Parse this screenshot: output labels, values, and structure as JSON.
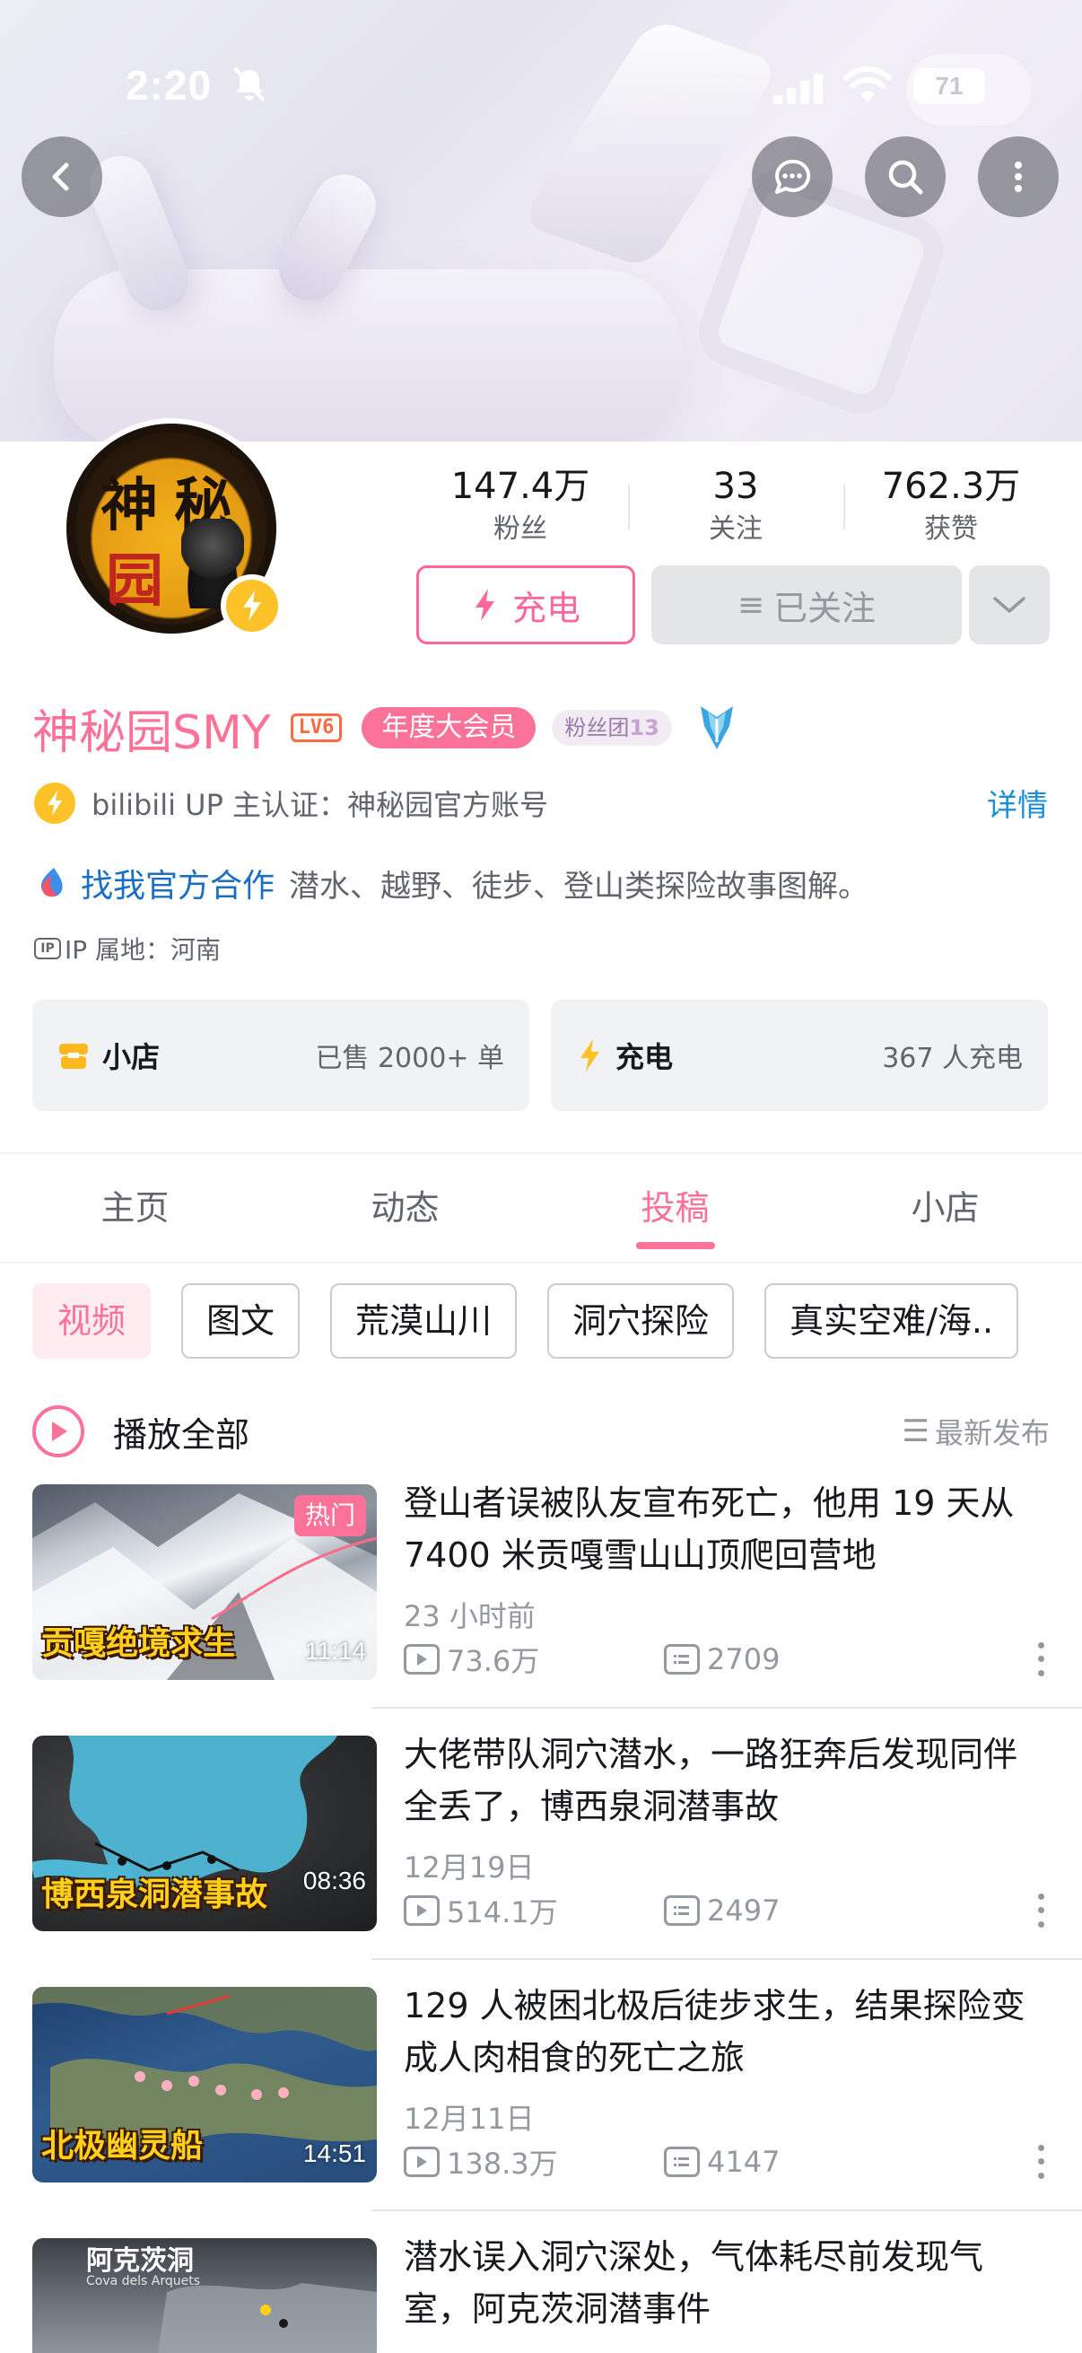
{
  "status_bar": {
    "time": "2:20",
    "battery": "71"
  },
  "header": {
    "icons": [
      "back-icon",
      "message-icon",
      "search-icon",
      "more-icon"
    ]
  },
  "profile": {
    "avatar_text": [
      "神",
      "秘",
      "园"
    ],
    "stats": [
      {
        "value": "147.4万",
        "label": "粉丝"
      },
      {
        "value": "33",
        "label": "关注"
      },
      {
        "value": "762.3万",
        "label": "获赞"
      }
    ],
    "charge_button": "充电",
    "followed_button": "已关注",
    "name": "神秘园SMY",
    "level": "LV6",
    "vip": "年度大会员",
    "fan_group": "粉丝团",
    "fan_level": "13",
    "auth": "bilibili UP 主认证：神秘园官方账号",
    "auth_detail": "详情",
    "bio_link": "找我官方合作",
    "bio": "潜水、越野、徒步、登山类探险故事图解。",
    "ip_badge": "IP",
    "ip": "IP 属地：河南"
  },
  "cards": {
    "shop": {
      "title": "小店",
      "value": "已售 2000+ 单"
    },
    "charge": {
      "title": "充电",
      "value": "367 人充电"
    }
  },
  "tabs": [
    {
      "label": "主页"
    },
    {
      "label": "动态"
    },
    {
      "label": "投稿",
      "active": true
    },
    {
      "label": "小店"
    }
  ],
  "chips": [
    "视频",
    "图文",
    "荒漠山川",
    "洞穴探险",
    "真实空难/海.."
  ],
  "play_all": {
    "label": "播放全部",
    "sort": "最新发布"
  },
  "videos": [
    {
      "title": "登山者误被队友宣布死亡，他用 19 天从 7400 米贡嘎雪山山顶爬回营地",
      "date": "23 小时前",
      "views": "73.6万",
      "danmaku": "2709",
      "duration": "11:14",
      "thumb_text": "贡嘎绝境求生",
      "hot": "热门"
    },
    {
      "title": "大佬带队洞穴潜水，一路狂奔后发现同伴全丢了，博西泉洞潜事故",
      "date": "12月19日",
      "views": "514.1万",
      "danmaku": "2497",
      "duration": "08:36",
      "thumb_text": "博西泉洞潜事故"
    },
    {
      "title": "129 人被困北极后徒步求生，结果探险变成人肉相食的死亡之旅",
      "date": "12月11日",
      "views": "138.3万",
      "danmaku": "4147",
      "duration": "14:51",
      "thumb_text": "北极幽灵船"
    },
    {
      "title": "潜水误入洞穴深处，气体耗尽前发现气室，阿克茨洞潜事件",
      "thumb_text": "阿克茨洞",
      "thumb_sub": "Cova dels Arquets"
    }
  ],
  "colors": {
    "accent": "#fb7299",
    "link": "#1b8fd8",
    "secondary_text": "#61666d",
    "muted": "#9499a0"
  }
}
